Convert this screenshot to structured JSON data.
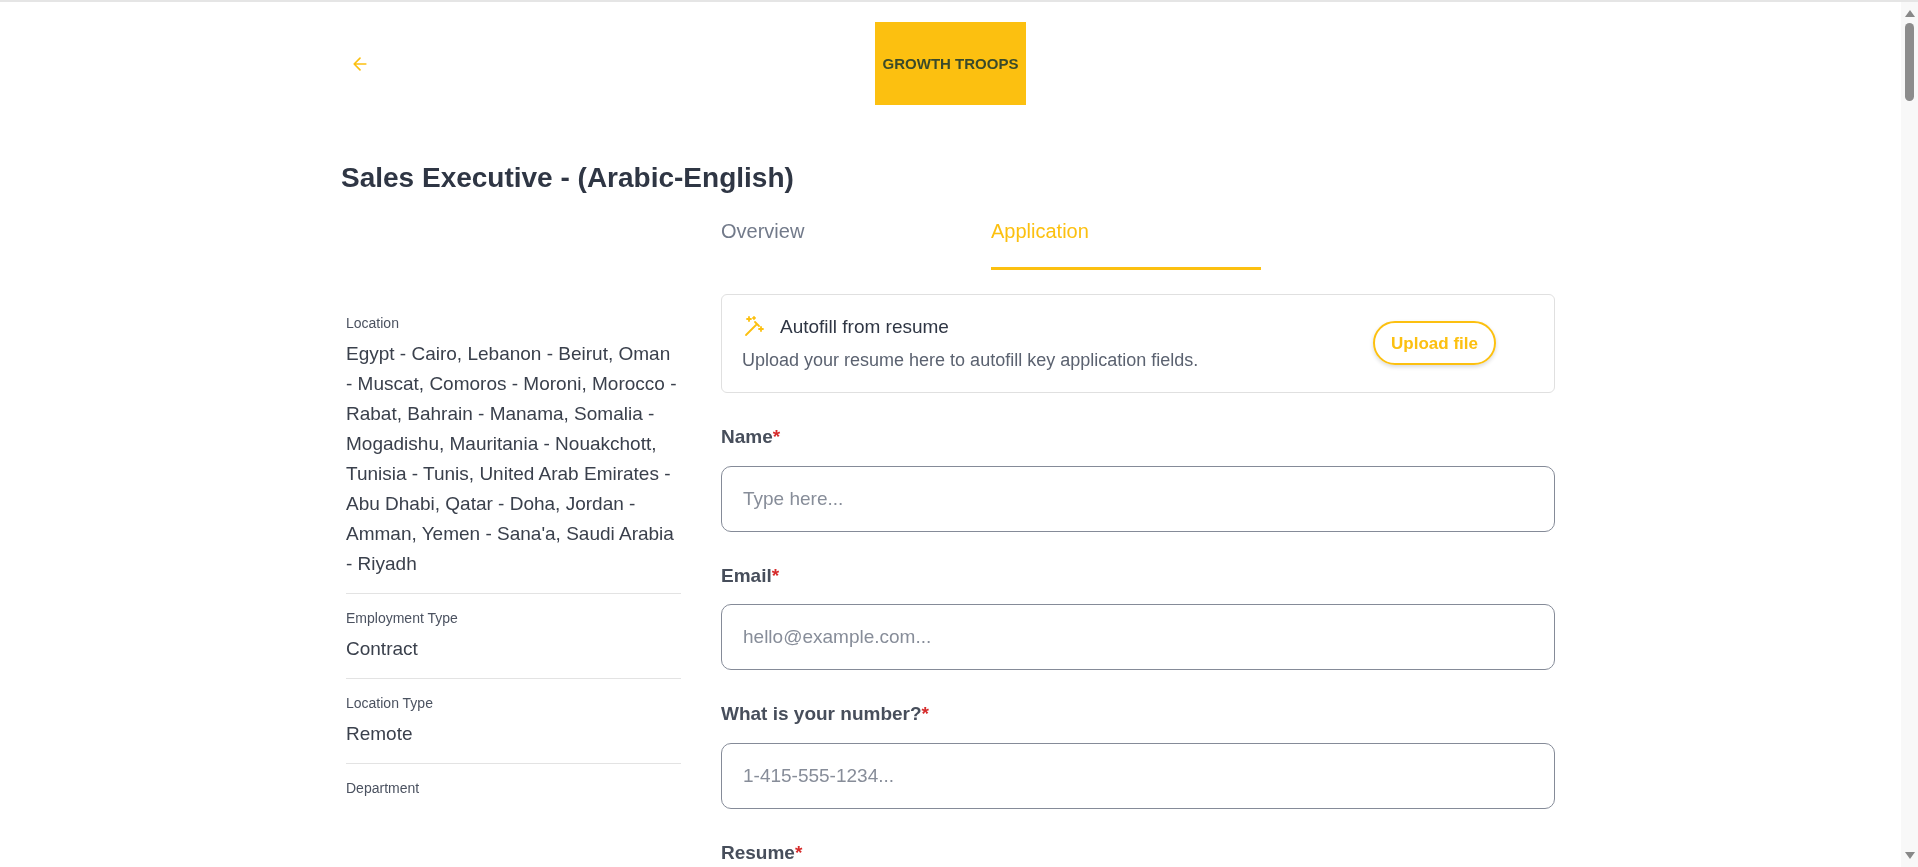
{
  "header": {
    "logo_text": "GROWTH TROOPS"
  },
  "job_title": "Sales Executive - (Arabic-English)",
  "tabs": [
    {
      "label": "Overview",
      "selected": false
    },
    {
      "label": "Application",
      "selected": true
    }
  ],
  "details": [
    {
      "label": "Location",
      "value": "Egypt - Cairo, Lebanon - Beirut, Oman - Muscat, Comoros - Moroni, Morocco - Rabat, Bahrain - Manama, Somalia - Mogadishu, Mauritania - Nouakchott, Tunisia - Tunis, United Arab Emirates - Abu Dhabi, Qatar - Doha, Jordan - Amman, Yemen - Sana'a, Saudi Arabia - Riyadh"
    },
    {
      "label": "Employment Type",
      "value": "Contract"
    },
    {
      "label": "Location Type",
      "value": "Remote"
    },
    {
      "label": "Department"
    }
  ],
  "autofill": {
    "title": "Autofill from resume",
    "description": "Upload your resume here to autofill key application fields.",
    "button": "Upload file"
  },
  "fields": [
    {
      "label": "Name",
      "required_mark": "*",
      "placeholder": "Type here..."
    },
    {
      "label": "Email",
      "required_mark": "*",
      "placeholder": "hello@example.com..."
    },
    {
      "label": "What is your number?",
      "required_mark": "*",
      "placeholder": "1-415-555-1234..."
    },
    {
      "label": "Resume",
      "required_mark": "*"
    }
  ]
}
